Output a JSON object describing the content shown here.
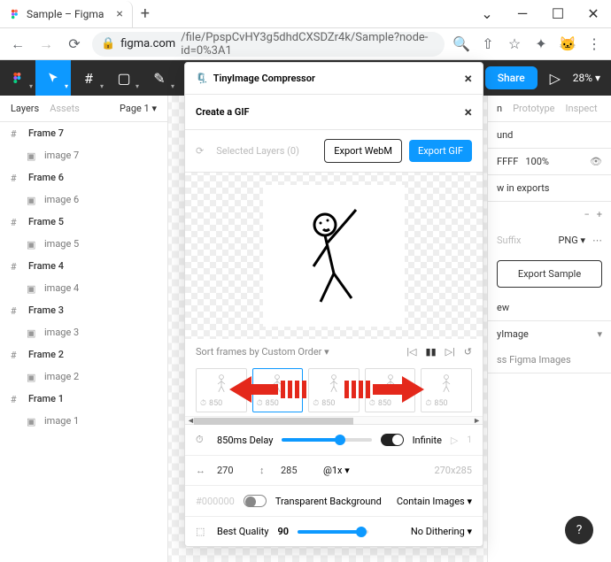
{
  "browser": {
    "tab_title": "Sample – Figma",
    "url_domain": "figma.com",
    "url_path": "/file/PpspCvHY3g5dhdCXSDZr4k/Sample?node-id=0%3A1"
  },
  "figma_toolbar": {
    "share_label": "Share",
    "zoom": "28%"
  },
  "left_panel": {
    "tabs": {
      "layers": "Layers",
      "assets": "Assets"
    },
    "page_label": "Page 1",
    "frames": [
      {
        "name": "Frame 7",
        "child": "image 7"
      },
      {
        "name": "Frame 6",
        "child": "image 6"
      },
      {
        "name": "Frame 5",
        "child": "image 5"
      },
      {
        "name": "Frame 4",
        "child": "image 4"
      },
      {
        "name": "Frame 3",
        "child": "image 3"
      },
      {
        "name": "Frame 2",
        "child": "image 2"
      },
      {
        "name": "Frame 1",
        "child": "image 1"
      }
    ]
  },
  "right_panel": {
    "tabs": {
      "design": "n",
      "prototype": "Prototype",
      "inspect": "Inspect"
    },
    "bg_label": "und",
    "hex": "FFFF",
    "opacity": "100%",
    "show_exports": "w in exports",
    "suffix_label": "Suffix",
    "format": "PNG",
    "export_btn": "Export Sample",
    "preview_label": "ew",
    "tiny_label": "yImage",
    "tiny_sub": "ss Figma Images"
  },
  "plugin": {
    "title": "TinyImage Compressor",
    "subtitle": "Create a GIF",
    "selected_layers": "Selected Layers (0)",
    "webm_btn": "Export WebM",
    "gif_btn": "Export GIF",
    "sort_label": "Sort frames by Custom Order",
    "thumbs_ms": [
      "850",
      "850",
      "850",
      "850",
      "850"
    ],
    "delay_label": "850ms Delay",
    "infinite_label": "Infinite",
    "width": "270",
    "height": "285",
    "scale": "@1x",
    "dims_readonly": "270x285",
    "hex_placeholder": "#000000",
    "transparent_label": "Transparent Background",
    "contain_label": "Contain Images",
    "quality_label": "Best Quality",
    "quality_value": "90",
    "dither_label": "No Dithering"
  },
  "help": "?"
}
